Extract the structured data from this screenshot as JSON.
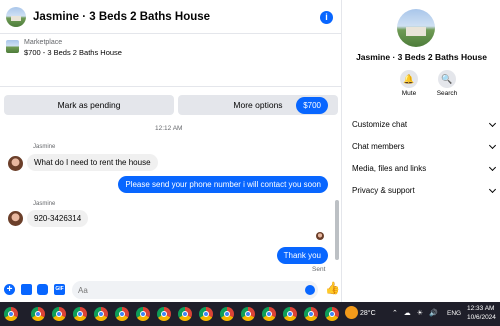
{
  "header": {
    "title": "Jasmine · 3 Beds 2 Baths House",
    "info_icon": "info-icon"
  },
  "marketplace": {
    "label": "Marketplace",
    "item": "$700 - 3 Beds 2 Baths House",
    "mark_pending_label": "Mark as pending",
    "more_options_label": "More options"
  },
  "thread": {
    "messages": [
      {
        "direction": "out",
        "text": "$700"
      },
      {
        "direction": "timestamp",
        "text": "12:12 AM"
      },
      {
        "direction": "in",
        "sender": "Jasmine",
        "text": "What do I need to rent the house"
      },
      {
        "direction": "out",
        "text": "Please send your phone number i will contact you soon"
      },
      {
        "direction": "in",
        "sender": "Jasmine",
        "text": "920-3426314"
      },
      {
        "direction": "out",
        "text": "Thank you"
      }
    ],
    "status": "Sent"
  },
  "composer": {
    "placeholder": "Aa",
    "icons": [
      "plus-icon",
      "photo-icon",
      "sticker-icon",
      "gif-icon",
      "emoji-icon",
      "like-icon"
    ]
  },
  "details": {
    "title": "Jasmine · 3 Beds 2 Baths House",
    "mute_label": "Mute",
    "search_label": "Search",
    "menu": [
      {
        "label": "Customize chat"
      },
      {
        "label": "Chat members"
      },
      {
        "label": "Media, files and links"
      },
      {
        "label": "Privacy & support"
      }
    ]
  },
  "taskbar": {
    "weather": "28°C",
    "language": "ENG",
    "time": "12:33 AM",
    "date": "10/6/2024"
  },
  "colors": {
    "accent": "#0866ff",
    "incoming_bubble": "#f0f0f0",
    "button_bg": "#e4e6eb",
    "taskbar_bg": "#1f1f2a"
  }
}
